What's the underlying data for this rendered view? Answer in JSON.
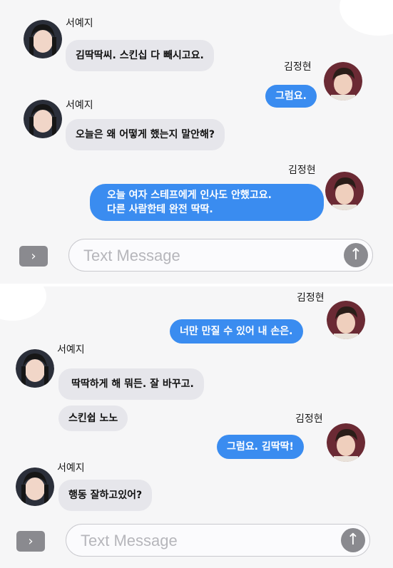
{
  "colors": {
    "outgoing": "#3a8cf0",
    "incoming": "#e6e6eb",
    "background": "#f6f6f7",
    "control": "#8a8a8f"
  },
  "screens": [
    {
      "messages": [
        {
          "sender": "서예지",
          "side": "left",
          "text": "김딱딱씨. 스킨십 다 빼시고요."
        },
        {
          "sender": "김정현",
          "side": "right",
          "text": "그럼요."
        },
        {
          "sender": "서예지",
          "side": "left",
          "text": "오늘은 왜 어떻게 했는지 말안해?"
        },
        {
          "sender": "김정현",
          "side": "right",
          "lines": [
            "오늘 여자 스테프에게 인사도 안했고요.",
            "다른 사람한테 완전 딱딱."
          ]
        }
      ],
      "composer": {
        "placeholder": "Text Message",
        "expand_icon": "chevron-right-icon",
        "send_icon": "arrow-up-icon"
      }
    },
    {
      "messages": [
        {
          "sender": "김정현",
          "side": "right",
          "text": "너만 만질 수 있어 내 손은."
        },
        {
          "sender": "서예지",
          "side": "left",
          "text": "딱딱하게 해 뭐든. 잘 바꾸고."
        },
        {
          "sender": "서예지",
          "side": "left",
          "text": "스킨쉽 노노"
        },
        {
          "sender": "김정현",
          "side": "right",
          "text": "그럼요. 김딱딱!"
        },
        {
          "sender": "서예지",
          "side": "left",
          "text": "행동 잘하고있어?"
        }
      ],
      "composer": {
        "placeholder": "Text Message",
        "expand_icon": "chevron-right-icon",
        "send_icon": "arrow-up-icon"
      }
    }
  ]
}
